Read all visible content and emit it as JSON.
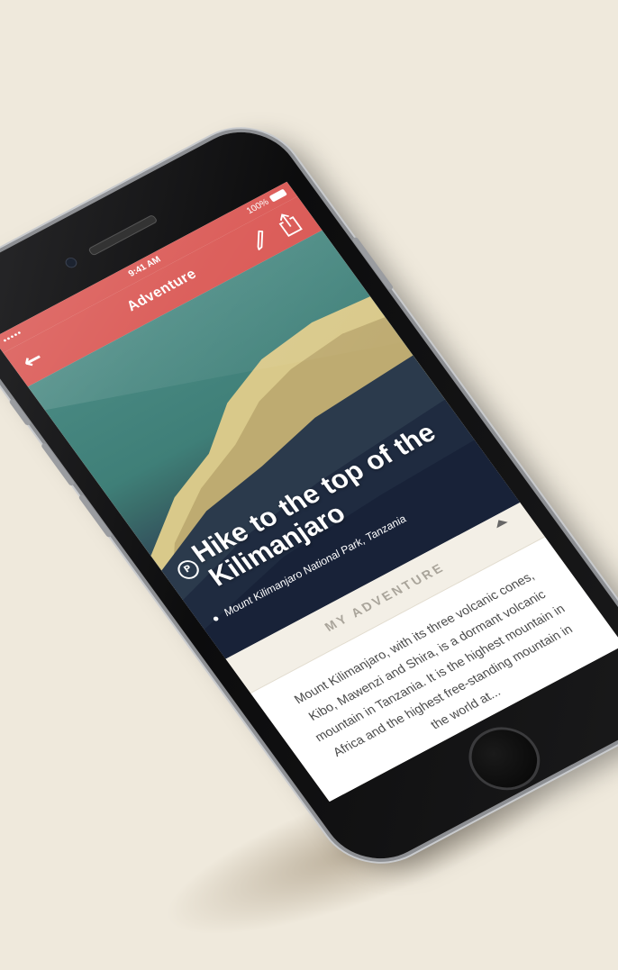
{
  "status_bar": {
    "signal": "•••••",
    "time": "9:41 AM",
    "battery": "100%"
  },
  "nav": {
    "title": "Adventure",
    "back_icon": "arrow-left-icon",
    "edit_icon": "pencil-icon",
    "share_icon": "share-icon"
  },
  "hero": {
    "title": "Hike to the top of the Kilimanjaro",
    "location": "Mount Kilimanjaro National Park, Tanzania",
    "badge_icon": "brand-badge-icon",
    "pin_icon": "location-pin-icon"
  },
  "section": {
    "title": "MY ADVENTURE",
    "body": "Mount Kilimanjaro, with its three volcanic cones, Kibo, Mawenzi and Shira, is a dormant volcanic mountain in Tanzania. It is the highest mountain in Africa and the highest free-standing mountain in the world at..."
  },
  "colors": {
    "accent": "#d9534f",
    "background": "#efe9dc",
    "section_title": "#a9a49a"
  }
}
